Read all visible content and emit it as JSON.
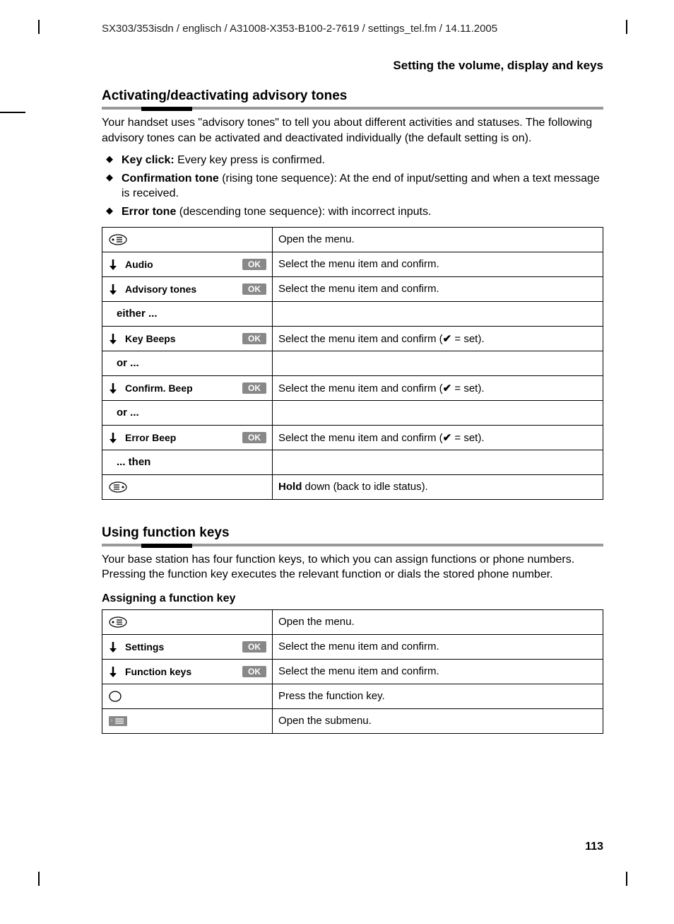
{
  "header": "SX303/353isdn / englisch / A31008-X353-B100-2-7619 / settings_tel.fm / 14.11.2005",
  "pageTitle": "Setting the volume, display and keys",
  "section1": {
    "heading": "Activating/deactivating advisory tones",
    "intro": "Your handset uses \"advisory tones\" to tell you about different activities and statuses. The following advisory tones can be activated and deactivated individually (the default setting is on).",
    "bullets": [
      {
        "bold": "Key click:",
        "rest": " Every key press is confirmed."
      },
      {
        "bold": "Confirmation tone",
        "rest": " (rising tone sequence): At the end of input/setting and when a text message is received."
      },
      {
        "bold": "Error tone",
        "rest": " (descending tone sequence): with incorrect inputs."
      }
    ],
    "rows": [
      {
        "type": "menu",
        "desc": "Open the menu."
      },
      {
        "type": "nav",
        "label": "Audio",
        "ok": "OK",
        "desc": "Select the menu item and confirm."
      },
      {
        "type": "nav",
        "label": "Advisory tones",
        "ok": "OK",
        "desc": "Select the menu item and confirm."
      },
      {
        "type": "plain",
        "label": "either ...",
        "desc": ""
      },
      {
        "type": "nav",
        "label": "Key Beeps",
        "ok": "OK",
        "descPrefix": "Select the menu item and confirm (",
        "descSuffix": " = set)."
      },
      {
        "type": "plain",
        "label": "or ...",
        "desc": ""
      },
      {
        "type": "nav",
        "label": "Confirm. Beep",
        "ok": "OK",
        "descPrefix": "Select the menu item and confirm (",
        "descSuffix": " = set)."
      },
      {
        "type": "plain",
        "label": "or ...",
        "desc": ""
      },
      {
        "type": "nav",
        "label": "Error Beep",
        "ok": "OK",
        "descPrefix": "Select the menu item and confirm (",
        "descSuffix": " = set)."
      },
      {
        "type": "plain",
        "label": "... then",
        "desc": ""
      },
      {
        "type": "hold",
        "descBold": "Hold",
        "descRest": " down (back to idle status)."
      }
    ]
  },
  "section2": {
    "heading": "Using function keys",
    "intro": "Your base station has four function keys, to which you can assign functions or phone numbers. Pressing the function key executes the relevant function or dials the stored phone number.",
    "subheading": "Assigning a function key",
    "rows": [
      {
        "type": "menu",
        "desc": "Open the menu."
      },
      {
        "type": "nav",
        "label": "Settings",
        "ok": "OK",
        "desc": "Select the menu item and confirm."
      },
      {
        "type": "nav",
        "label": "Function keys",
        "ok": "OK",
        "desc": "Select the menu item and confirm."
      },
      {
        "type": "circle",
        "desc": "Press the function key."
      },
      {
        "type": "submenu",
        "desc": "Open the submenu."
      }
    ]
  },
  "pageNumber": "113"
}
